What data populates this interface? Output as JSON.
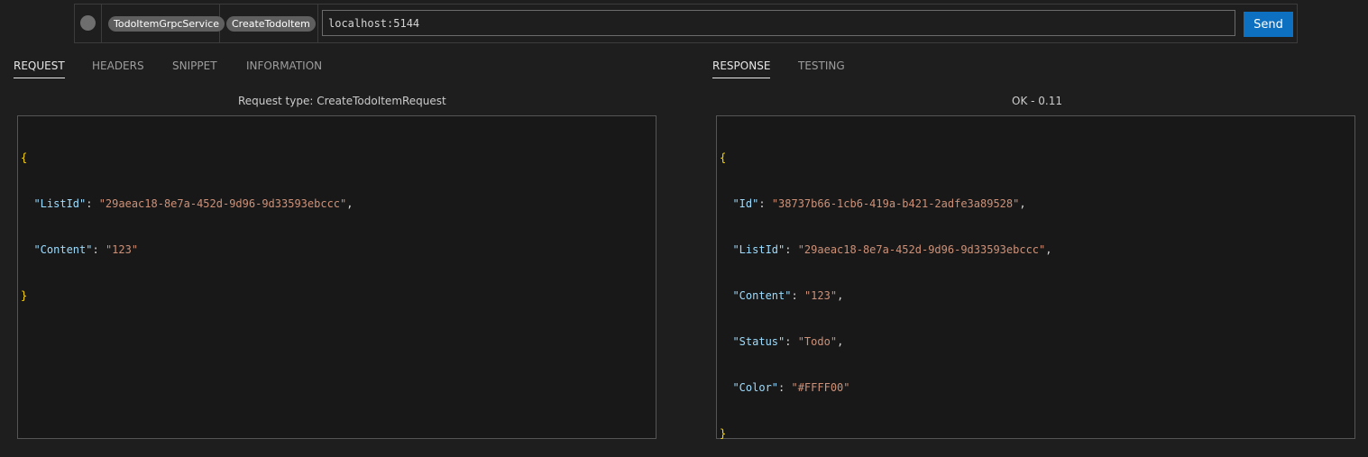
{
  "toolbar": {
    "service": "TodoItemGrpcService",
    "method": "CreateTodoItem",
    "url": "localhost:5144",
    "send_label": "Send"
  },
  "request_tabs": [
    "REQUEST",
    "HEADERS",
    "SNIPPET",
    "INFORMATION"
  ],
  "response_tabs": [
    "RESPONSE",
    "TESTING"
  ],
  "request": {
    "type_label": "Request type: CreateTodoItemRequest",
    "fields": [
      {
        "key": "\"ListId\"",
        "value": "\"29aeac18-8e7a-452d-9d96-9d33593ebccc\""
      },
      {
        "key": "\"Content\"",
        "value": "\"123\""
      }
    ]
  },
  "response": {
    "status_label": "OK - 0.11",
    "fields": [
      {
        "key": "\"Id\"",
        "value": "\"38737b66-1cb6-419a-b421-2adfe3a89528\""
      },
      {
        "key": "\"ListId\"",
        "value": "\"29aeac18-8e7a-452d-9d96-9d33593ebccc\""
      },
      {
        "key": "\"Content\"",
        "value": "\"123\""
      },
      {
        "key": "\"Status\"",
        "value": "\"Todo\""
      },
      {
        "key": "\"Color\"",
        "value": "\"#FFFF00\""
      }
    ]
  },
  "code": {
    "open_brace": "{",
    "close_brace": "}",
    "colon": ": ",
    "comma": ","
  }
}
